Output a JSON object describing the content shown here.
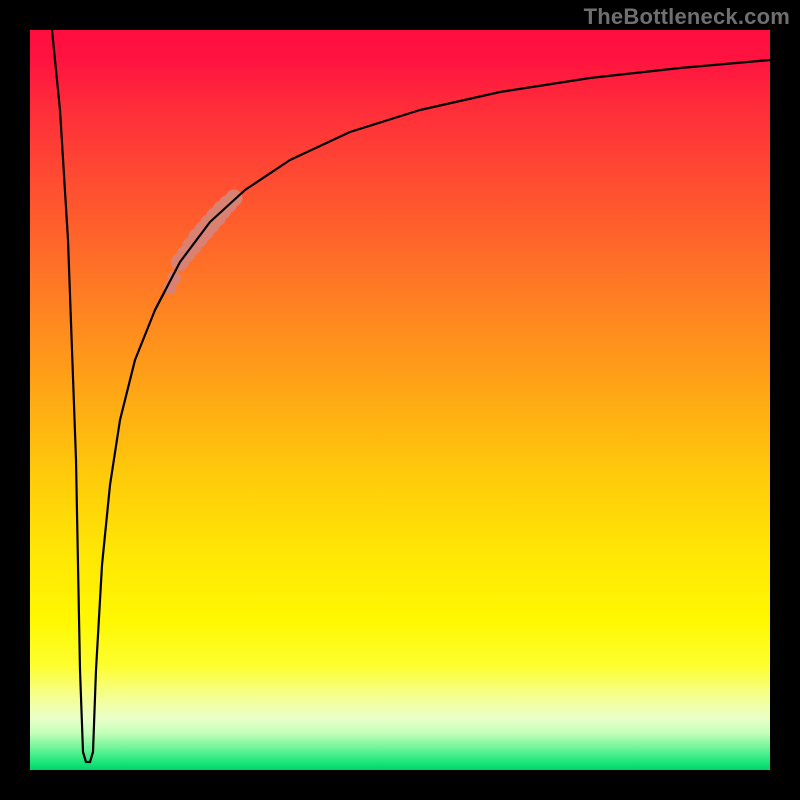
{
  "watermark": "TheBottleneck.com",
  "chart_data": {
    "type": "line",
    "title": "",
    "xlabel": "",
    "ylabel": "",
    "xlim": [
      0,
      100
    ],
    "ylim": [
      0,
      100
    ],
    "grid": false,
    "legend": false,
    "background_gradient": {
      "top": "#ff0d3f",
      "bottom": "#00d36b",
      "note": "vertical gradient red→orange→yellow→green"
    },
    "series": [
      {
        "name": "bottleneck-curve",
        "note": "y ≈ 100 at x=0, sharp dip to ~0 near x≈7, then monotone rise toward ~96 at x=100",
        "x": [
          0,
          2,
          4,
          6,
          7,
          8,
          9,
          10,
          12,
          14,
          16,
          18,
          20,
          22,
          25,
          30,
          35,
          40,
          50,
          60,
          70,
          80,
          90,
          100
        ],
        "y": [
          100,
          72,
          44,
          16,
          1,
          1,
          16,
          26,
          40,
          50,
          57,
          62,
          66,
          69,
          73,
          78,
          82,
          85,
          88,
          90.5,
          92.5,
          94,
          95.2,
          96
        ]
      }
    ],
    "highlight_segment": {
      "note": "thick salmon band along the curve between roughly x=20 and x=26",
      "x_range": [
        20,
        26
      ],
      "y_range_approx": [
        58,
        71
      ],
      "color": "#d98173"
    }
  }
}
